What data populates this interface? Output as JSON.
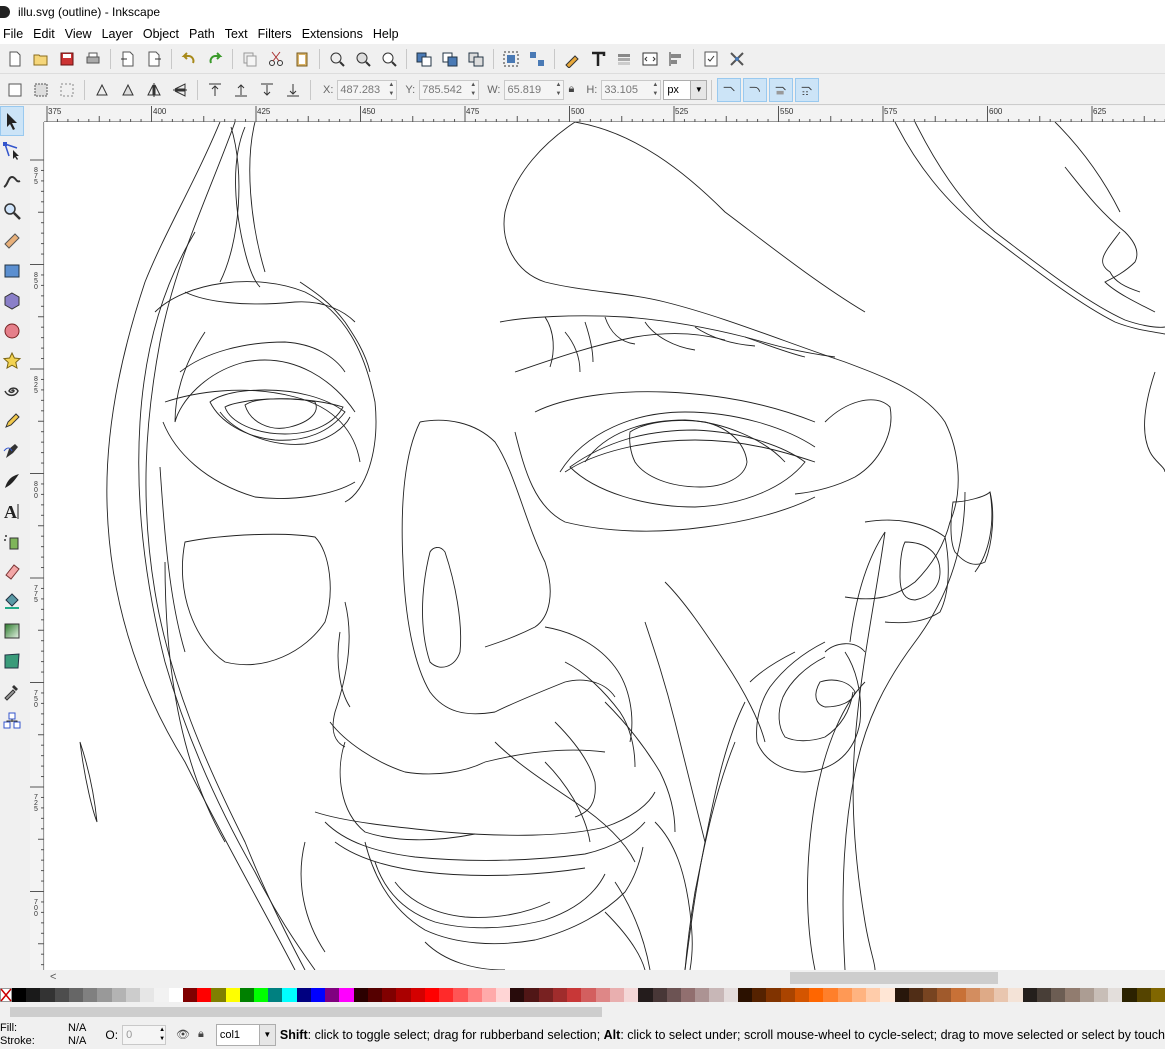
{
  "window": {
    "title": "illu.svg (outline) - Inkscape"
  },
  "menu": [
    "File",
    "Edit",
    "View",
    "Layer",
    "Object",
    "Path",
    "Text",
    "Filters",
    "Extensions",
    "Help"
  ],
  "select_toolbar": {
    "x_label": "X:",
    "x_value": "487.283",
    "y_label": "Y:",
    "y_value": "785.542",
    "w_label": "W:",
    "w_value": "65.819",
    "h_label": "H:",
    "h_value": "33.105",
    "unit": "px"
  },
  "ruler": {
    "h_labels": [
      "375",
      "400",
      "425",
      "450",
      "475",
      "500",
      "525",
      "550",
      "575",
      "600",
      "625"
    ],
    "v_labels": [
      "875",
      "850",
      "825",
      "800",
      "775",
      "750",
      "725",
      "700"
    ]
  },
  "palette": [
    "#000000",
    "#1a1a1a",
    "#333333",
    "#4d4d4d",
    "#666666",
    "#808080",
    "#999999",
    "#b3b3b3",
    "#cccccc",
    "#e6e6e6",
    "#f2f2f2",
    "#ffffff",
    "#800000",
    "#ff0000",
    "#808000",
    "#ffff00",
    "#008000",
    "#00ff00",
    "#008080",
    "#00ffff",
    "#000080",
    "#0000ff",
    "#800080",
    "#ff00ff",
    "#2b0000",
    "#550000",
    "#800000",
    "#aa0000",
    "#d40000",
    "#ff0000",
    "#ff2a2a",
    "#ff5555",
    "#ff8080",
    "#ffaaaa",
    "#ffd5d5",
    "#280b0b",
    "#501616",
    "#782121",
    "#a02c2c",
    "#c83737",
    "#d35f5f",
    "#de8787",
    "#e9afaf",
    "#f4d7d7",
    "#241c1c",
    "#483737",
    "#6c5353",
    "#916f6f",
    "#ac9393",
    "#c8b7b7",
    "#e3dbdb",
    "#2b1100",
    "#552200",
    "#803300",
    "#aa4400",
    "#d45500",
    "#ff6600",
    "#ff7f2a",
    "#ff9955",
    "#ffb380",
    "#ffccaa",
    "#ffe6d5",
    "#28170b",
    "#502d16",
    "#784421",
    "#a05a2c",
    "#c87137",
    "#d38d5f",
    "#deaa87",
    "#e9c6af",
    "#f4e3d7",
    "#241f1c",
    "#483e37",
    "#6c5d53",
    "#917c6f",
    "#ac9d93",
    "#c8beb7",
    "#e3dedb",
    "#2b2200",
    "#554400",
    "#806600"
  ],
  "status": {
    "fill_label": "Fill:",
    "fill_value": "N/A",
    "stroke_label": "Stroke:",
    "stroke_value": "N/A",
    "opacity_label": "O:",
    "opacity_value": "0",
    "layer": "col1",
    "message_shift": "Shift",
    "message_1": ": click to toggle select; drag for rubberband selection; ",
    "message_alt": "Alt",
    "message_2": ": click to select under; scroll mouse-wheel to cycle-select; drag to move selected or select by touch"
  }
}
